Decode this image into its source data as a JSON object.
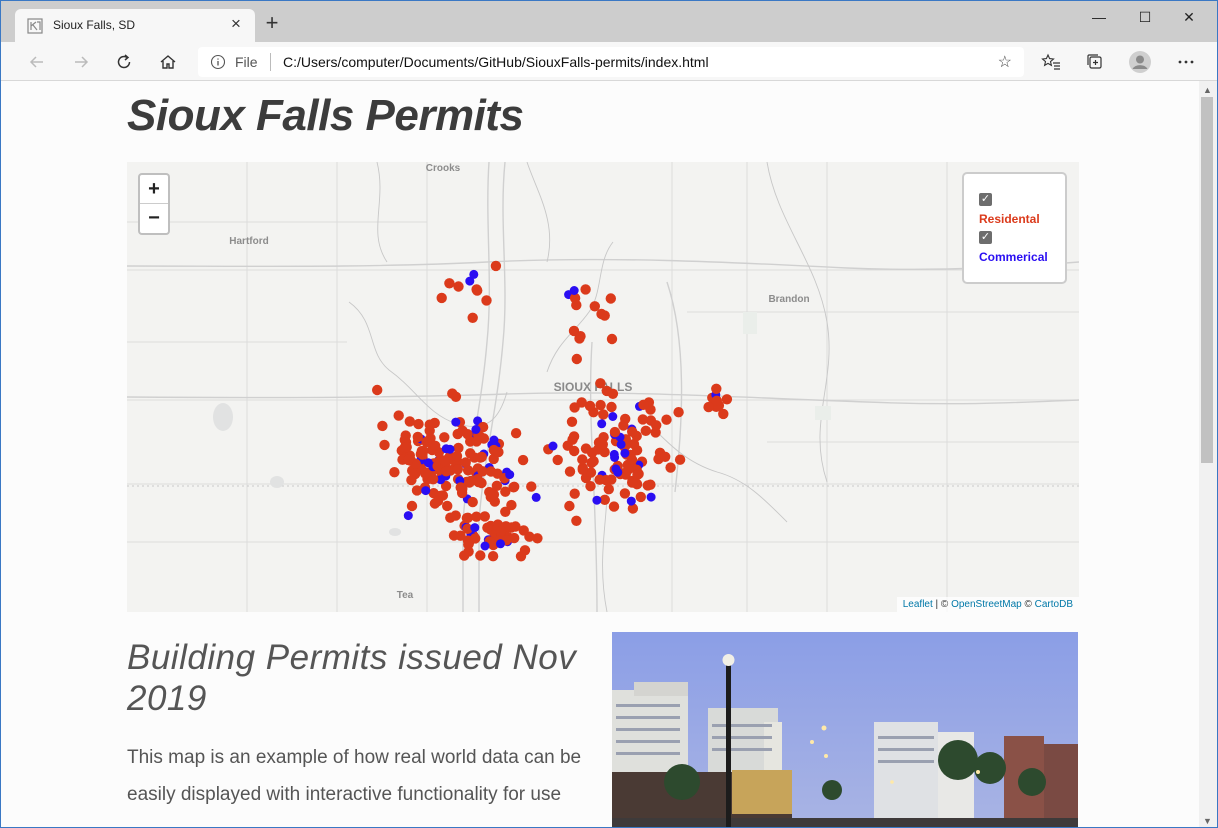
{
  "browser": {
    "tab_title": "Sioux Falls, SD",
    "address_scheme": "File",
    "url": "C:/Users/computer/Documents/GitHub/SiouxFalls-permits/index.html",
    "window_controls": {
      "minimize": "—",
      "maximize": "☐",
      "close": "✕"
    },
    "new_tab": "+",
    "tab_close": "×"
  },
  "page": {
    "title": "Sioux Falls Permits",
    "subheading": "Building Permits issued Nov 2019",
    "body": "This map is an example of how real world data can be easily displayed with interactive functionality for use"
  },
  "map": {
    "zoom_in": "+",
    "zoom_out": "−",
    "place_labels": {
      "crooks": "Crooks",
      "hartford": "Hartford",
      "brandon": "Brandon",
      "sioux_falls": "SIOUX FALLS",
      "tea": "Tea"
    },
    "legend": {
      "residential": {
        "label": "Residental",
        "checked": true,
        "color": "#db3a1b"
      },
      "commercial": {
        "label": "Commerical",
        "checked": true,
        "color": "#2a0ef2"
      }
    },
    "attribution": {
      "leaflet": "Leaflet",
      "sep1": " | © ",
      "osm": "OpenStreetMap",
      "sep2": " © ",
      "carto": "CartoDB"
    }
  },
  "icons": [
    "tab-favicon-icon",
    "back-icon",
    "forward-icon",
    "refresh-icon",
    "home-icon",
    "info-icon",
    "star-icon",
    "favorites-icon",
    "collections-icon",
    "profile-icon",
    "more-icon"
  ]
}
